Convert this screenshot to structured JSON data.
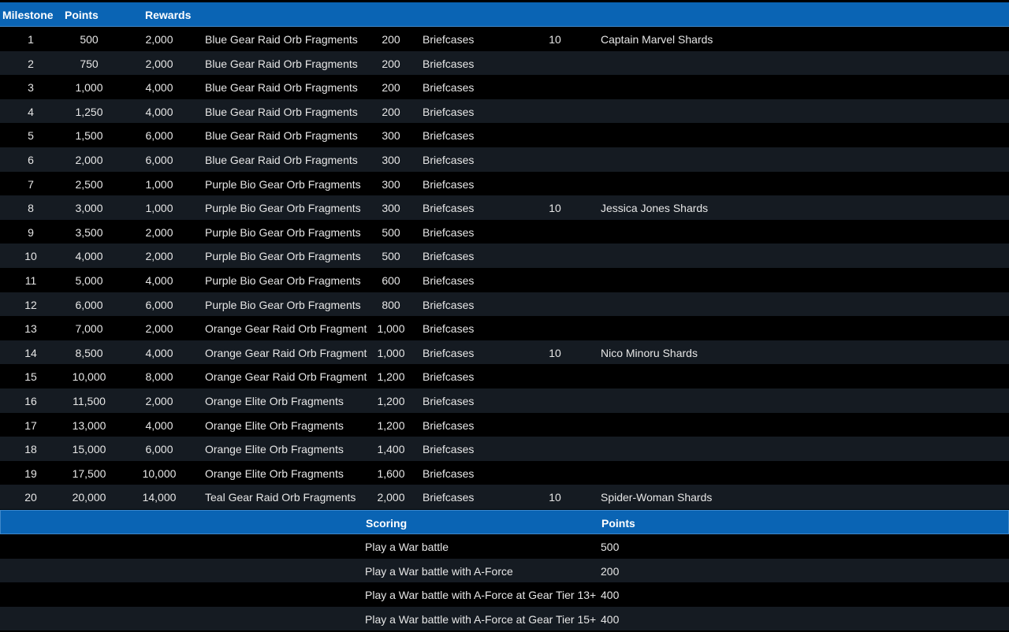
{
  "header": {
    "milestone": "Milestone",
    "points": "Points",
    "rewards": "Rewards"
  },
  "milestones": [
    {
      "milestone": "1",
      "points": "500",
      "r1_qty": "2,000",
      "r1_name": "Blue Gear Raid Orb Fragments",
      "r2_qty": "200",
      "r2_name": "Briefcases",
      "r3_qty": "10",
      "r3_name": "Captain Marvel Shards"
    },
    {
      "milestone": "2",
      "points": "750",
      "r1_qty": "2,000",
      "r1_name": "Blue Gear Raid Orb Fragments",
      "r2_qty": "200",
      "r2_name": "Briefcases",
      "r3_qty": "",
      "r3_name": ""
    },
    {
      "milestone": "3",
      "points": "1,000",
      "r1_qty": "4,000",
      "r1_name": "Blue Gear Raid Orb Fragments",
      "r2_qty": "200",
      "r2_name": "Briefcases",
      "r3_qty": "",
      "r3_name": ""
    },
    {
      "milestone": "4",
      "points": "1,250",
      "r1_qty": "4,000",
      "r1_name": "Blue Gear Raid Orb Fragments",
      "r2_qty": "200",
      "r2_name": "Briefcases",
      "r3_qty": "",
      "r3_name": ""
    },
    {
      "milestone": "5",
      "points": "1,500",
      "r1_qty": "6,000",
      "r1_name": "Blue Gear Raid Orb Fragments",
      "r2_qty": "300",
      "r2_name": "Briefcases",
      "r3_qty": "",
      "r3_name": ""
    },
    {
      "milestone": "6",
      "points": "2,000",
      "r1_qty": "6,000",
      "r1_name": "Blue Gear Raid Orb Fragments",
      "r2_qty": "300",
      "r2_name": "Briefcases",
      "r3_qty": "",
      "r3_name": ""
    },
    {
      "milestone": "7",
      "points": "2,500",
      "r1_qty": "1,000",
      "r1_name": "Purple Bio Gear Orb Fragments",
      "r2_qty": "300",
      "r2_name": "Briefcases",
      "r3_qty": "",
      "r3_name": ""
    },
    {
      "milestone": "8",
      "points": "3,000",
      "r1_qty": "1,000",
      "r1_name": "Purple Bio Gear Orb Fragments",
      "r2_qty": "300",
      "r2_name": "Briefcases",
      "r3_qty": "10",
      "r3_name": "Jessica Jones Shards"
    },
    {
      "milestone": "9",
      "points": "3,500",
      "r1_qty": "2,000",
      "r1_name": "Purple Bio Gear Orb Fragments",
      "r2_qty": "500",
      "r2_name": "Briefcases",
      "r3_qty": "",
      "r3_name": ""
    },
    {
      "milestone": "10",
      "points": "4,000",
      "r1_qty": "2,000",
      "r1_name": "Purple Bio Gear Orb Fragments",
      "r2_qty": "500",
      "r2_name": "Briefcases",
      "r3_qty": "",
      "r3_name": ""
    },
    {
      "milestone": "11",
      "points": "5,000",
      "r1_qty": "4,000",
      "r1_name": "Purple Bio Gear Orb Fragments",
      "r2_qty": "600",
      "r2_name": "Briefcases",
      "r3_qty": "",
      "r3_name": ""
    },
    {
      "milestone": "12",
      "points": "6,000",
      "r1_qty": "6,000",
      "r1_name": "Purple Bio Gear Orb Fragments",
      "r2_qty": "800",
      "r2_name": "Briefcases",
      "r3_qty": "",
      "r3_name": ""
    },
    {
      "milestone": "13",
      "points": "7,000",
      "r1_qty": "2,000",
      "r1_name": "Orange Gear Raid Orb Fragment",
      "r2_qty": "1,000",
      "r2_name": "Briefcases",
      "r3_qty": "",
      "r3_name": ""
    },
    {
      "milestone": "14",
      "points": "8,500",
      "r1_qty": "4,000",
      "r1_name": "Orange Gear Raid Orb Fragment",
      "r2_qty": "1,000",
      "r2_name": "Briefcases",
      "r3_qty": "10",
      "r3_name": "Nico Minoru Shards"
    },
    {
      "milestone": "15",
      "points": "10,000",
      "r1_qty": "8,000",
      "r1_name": "Orange Gear Raid Orb Fragment",
      "r2_qty": "1,200",
      "r2_name": "Briefcases",
      "r3_qty": "",
      "r3_name": ""
    },
    {
      "milestone": "16",
      "points": "11,500",
      "r1_qty": "2,000",
      "r1_name": "Orange Elite Orb Fragments",
      "r2_qty": "1,200",
      "r2_name": "Briefcases",
      "r3_qty": "",
      "r3_name": ""
    },
    {
      "milestone": "17",
      "points": "13,000",
      "r1_qty": "4,000",
      "r1_name": "Orange Elite Orb Fragments",
      "r2_qty": "1,200",
      "r2_name": "Briefcases",
      "r3_qty": "",
      "r3_name": ""
    },
    {
      "milestone": "18",
      "points": "15,000",
      "r1_qty": "6,000",
      "r1_name": "Orange Elite Orb Fragments",
      "r2_qty": "1,400",
      "r2_name": "Briefcases",
      "r3_qty": "",
      "r3_name": ""
    },
    {
      "milestone": "19",
      "points": "17,500",
      "r1_qty": "10,000",
      "r1_name": "Orange Elite Orb Fragments",
      "r2_qty": "1,600",
      "r2_name": "Briefcases",
      "r3_qty": "",
      "r3_name": ""
    },
    {
      "milestone": "20",
      "points": "20,000",
      "r1_qty": "14,000",
      "r1_name": "Teal Gear Raid Orb Fragments",
      "r2_qty": "2,000",
      "r2_name": "Briefcases",
      "r3_qty": "10",
      "r3_name": "Spider-Woman Shards"
    }
  ],
  "scoring_header": {
    "scoring": "Scoring",
    "points": "Points"
  },
  "scoring": [
    {
      "desc": "Play a War battle",
      "points": "500"
    },
    {
      "desc": "Play a War battle with A-Force",
      "points": "200"
    },
    {
      "desc": "Play a War battle with A-Force at Gear Tier 13+",
      "points": "400"
    },
    {
      "desc": "Play a War battle with A-Force at Gear Tier 15+",
      "points": "400"
    }
  ],
  "colors": {
    "header_blue": "#0a64b4",
    "row_dark": "#000000",
    "row_alt": "#151b22",
    "text": "#e6e6e6"
  }
}
